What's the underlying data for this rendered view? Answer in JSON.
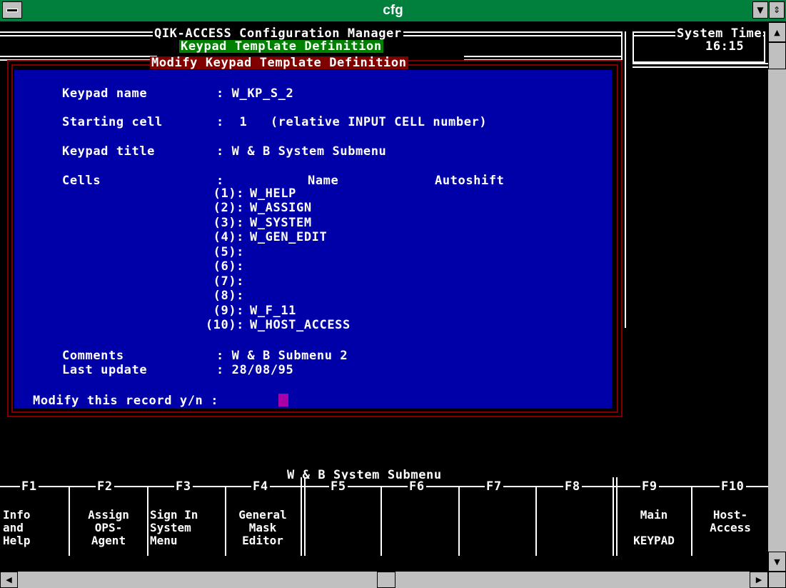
{
  "window": {
    "title": "cfg",
    "controls": {
      "menu": "system-menu-icon",
      "minimize": "down-arrow-icon",
      "restore": "up-down-arrow-icon"
    }
  },
  "header": {
    "app_title": "QIK-ACCESS Configuration Manager",
    "section_title": "Keypad Template Definition",
    "dialog_title": "Modify Keypad Template Definition",
    "system_time_label": "System Time",
    "system_time_value": "16:15"
  },
  "form": {
    "keypad_name_label": "Keypad name",
    "keypad_name_value": ": W_KP_S_2",
    "starting_cell_label": "Starting cell",
    "starting_cell_value": ":  1   (relative INPUT CELL number)",
    "keypad_title_label": "Keypad title",
    "keypad_title_value": ": W & B System Submenu",
    "cells_label": "Cells",
    "cells_colon": ":",
    "name_header": "Name",
    "autoshift_header": "Autoshift",
    "cells": [
      {
        "index": "(1):",
        "name": "W_HELP"
      },
      {
        "index": "(2):",
        "name": "W_ASSIGN"
      },
      {
        "index": "(3):",
        "name": "W_SYSTEM"
      },
      {
        "index": "(4):",
        "name": "W_GEN_EDIT"
      },
      {
        "index": "(5):",
        "name": ""
      },
      {
        "index": "(6):",
        "name": ""
      },
      {
        "index": "(7):",
        "name": ""
      },
      {
        "index": "(8):",
        "name": ""
      },
      {
        "index": "(9):",
        "name": "W_F_11"
      },
      {
        "index": "(10):",
        "name": "W_HOST_ACCESS"
      }
    ],
    "comments_label": "Comments",
    "comments_value": ": W & B Submenu 2",
    "last_update_label": "Last update",
    "last_update_value": ": 28/08/95",
    "prompt": "Modify this record y/n :"
  },
  "keypad_bar": {
    "title": "W & B System Submenu",
    "keys": [
      {
        "key": "F1",
        "label": "Info\nand\nHelp"
      },
      {
        "key": "F2",
        "label": "Assign\nOPS-\nAgent"
      },
      {
        "key": "F3",
        "label": "Sign In\nSystem\nMenu"
      },
      {
        "key": "F4",
        "label": "General\nMask\nEditor"
      },
      {
        "key": "F5",
        "label": ""
      },
      {
        "key": "F6",
        "label": ""
      },
      {
        "key": "F7",
        "label": ""
      },
      {
        "key": "F8",
        "label": ""
      },
      {
        "key": "F9",
        "label": "Main\n\nKEYPAD"
      },
      {
        "key": "F10",
        "label": "Host-\nAccess"
      }
    ]
  },
  "colors": {
    "title_bar": "#00803c",
    "panel_blue": "#0000a8",
    "dialog_red": "#800000",
    "section_green": "#008000",
    "cursor_magenta": "#a800a8",
    "scroll_gray": "#c0c0c0"
  }
}
